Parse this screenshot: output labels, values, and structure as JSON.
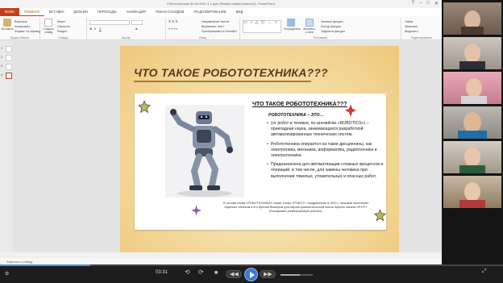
{
  "window": {
    "title": "Робототехника 30.06.2021 3-1.pptx [Режим совместимости] - PowerPoint"
  },
  "tabs": [
    "ФАЙЛ",
    "ГЛАВНАЯ",
    "ВСТАВКА",
    "ДИЗАЙН",
    "ПЕРЕХОДЫ",
    "АНИМАЦИЯ",
    "ПОКАЗ СЛАЙДОВ",
    "РЕЦЕНЗИРОВАНИЕ",
    "ВИД"
  ],
  "ribbon": {
    "paste_label": "Вставить",
    "cut": "Вырезать",
    "copy": "Копировать",
    "format_painter": "Формат по образцу",
    "create_slide": "Создать слайд",
    "layout": "Макет",
    "reset": "Сбросить",
    "section": "Раздел",
    "group_clipboard": "Буфер обмена",
    "group_slides": "Слайды",
    "group_font": "Шрифт",
    "group_paragraph": "Абзац",
    "group_drawing": "Рисование",
    "group_editing": "Редактирование",
    "text_direction": "Направление текста",
    "align_text": "Выровнять текст",
    "convert_smartart": "Преобразовать в SmartArt",
    "arrange": "Упорядочить",
    "quick_styles": "Экспресс-стили",
    "shape_fill": "Заливка фигуры",
    "shape_outline": "Контур фигуры",
    "shape_effects": "Эффекты фигуры",
    "find": "Найти",
    "replace": "Заменить",
    "select": "Выделить"
  },
  "thumbnails": [
    "1",
    "2",
    "3",
    "4"
  ],
  "slide": {
    "title": "ЧТО ТАКОЕ РОБОТОТЕХНИКА???",
    "card_title": "ЧТО ТАКОЕ РОБОТОТЕХНИКА???",
    "subtitle": "РОБОТОТЕХНИКА – ЭТО…",
    "bullets": [
      "(от робот и техника; по-английски «ROBOTICS») – прикладная наука, занимающаяся разработкой автоматизированных технических систем.",
      "Робототехника опирается на такие дисциплины, как электроника, механика, информатика, радиотехника и электротехника.",
      "Предназначена для автоматизации сложных процессов и операций, в том числе, для замены человека при выполнении тяжелых, утомительных и опасных работ."
    ],
    "footnote": "В основе слова «РОБОТЕХНИКА» лежит слово «РОБОТ», придуманное в 1920 г. чешским писателем Карелом Чапеком и его братом Йозефом для научно-фантастической пьесы Карела Чапека «Р.У.Р.» (Россумские универсальные роботы)."
  },
  "notes_label": "Заметки к слайду",
  "player": {
    "time": "03:31",
    "progress": 0.18,
    "volume": 0.6
  },
  "colors": {
    "accent": "#c43e1c",
    "title": "#5b3a1a",
    "play": "#3b7bd5"
  }
}
